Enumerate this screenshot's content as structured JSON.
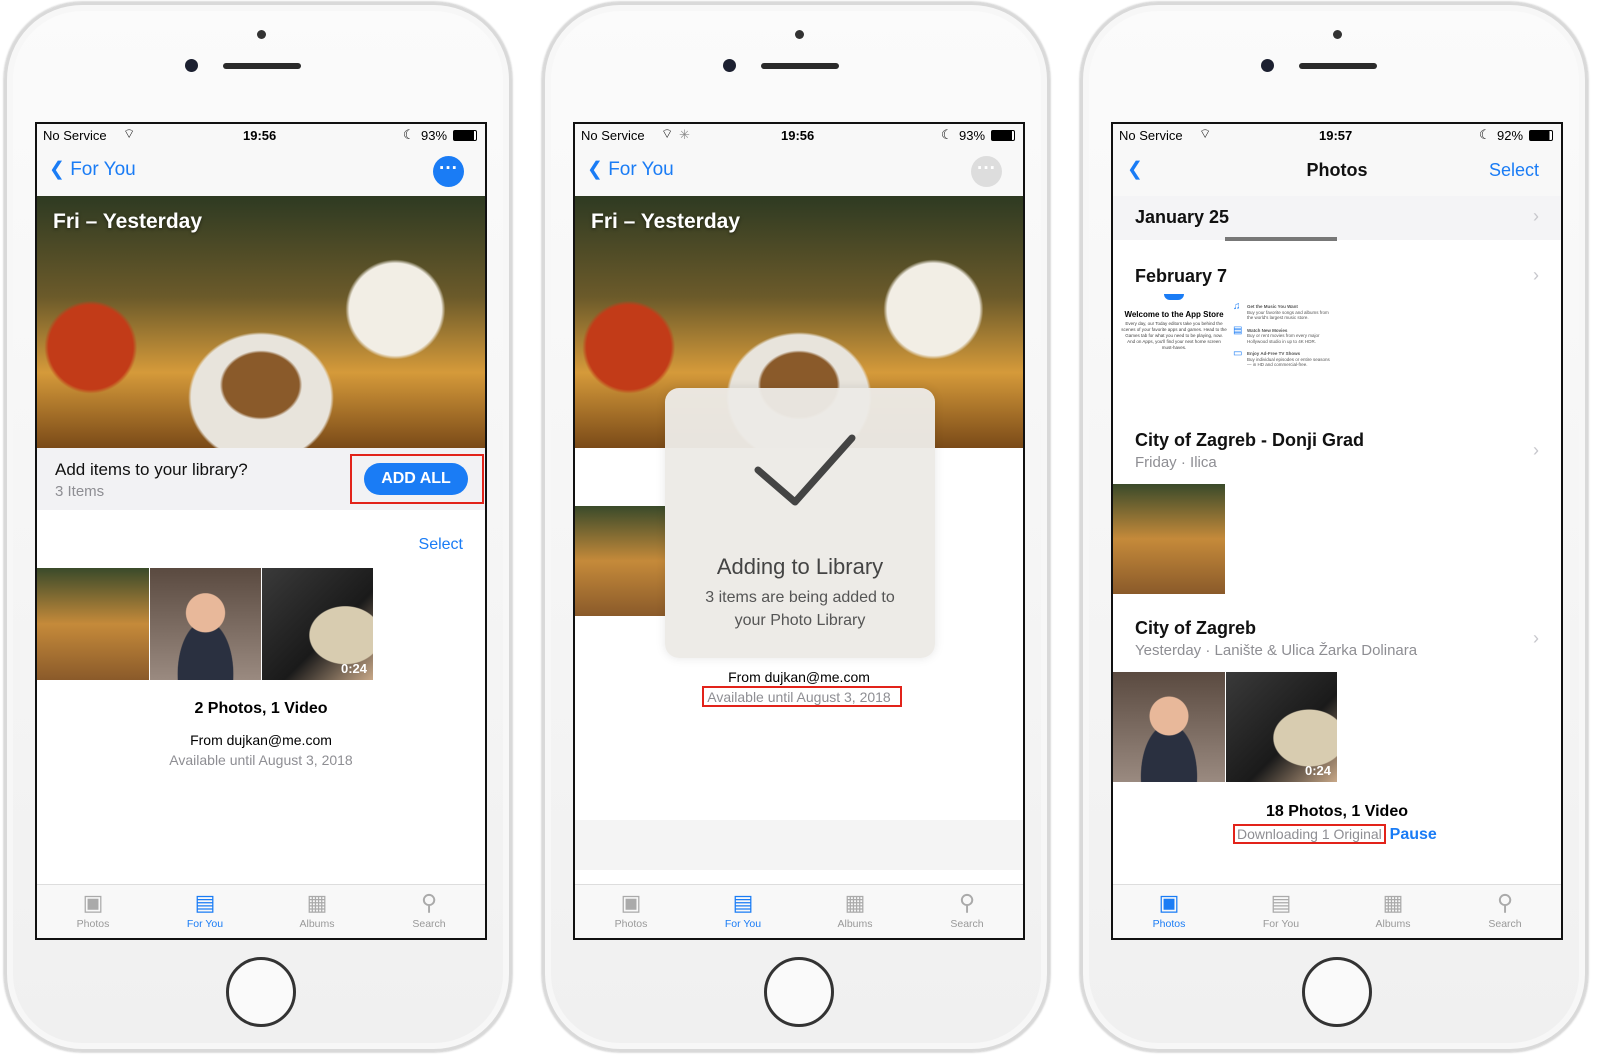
{
  "phones": [
    {
      "status": {
        "carrier": "No Service",
        "time": "19:56",
        "battery": "93%"
      },
      "nav": {
        "back_label": "For You"
      },
      "hero_title": "Fri – Yesterday",
      "banner": {
        "title": "Add items to your library?",
        "count": "3 Items",
        "button": "ADD ALL"
      },
      "select_label": "Select",
      "video_duration": "0:24",
      "summary": "2 Photos, 1 Video",
      "from": "From dujkan@me.com",
      "available": "Available until August 3, 2018"
    },
    {
      "status": {
        "carrier": "No Service",
        "time": "19:56",
        "battery": "93%"
      },
      "nav": {
        "back_label": "For You"
      },
      "hero_title": "Fri – Yesterday",
      "hud": {
        "title": "Adding to Library",
        "message": "3 items are being added to your Photo Library"
      },
      "from": "From dujkan@me.com",
      "available": "Available until August 3, 2018"
    },
    {
      "status": {
        "carrier": "No Service",
        "time": "19:57",
        "battery": "92%"
      },
      "nav": {
        "title": "Photos",
        "select": "Select"
      },
      "sections": [
        {
          "title": "January 25"
        },
        {
          "title": "February 7",
          "app_store": {
            "heading": "Welcome to the App Store",
            "body": "Every day, our Today editors take you behind the scenes of your favorite apps and games. Head to the Games tab for what you need to be playing, now. And on Apps, you'll find your next home screen must-haves.",
            "features": [
              {
                "title": "Get the Music You Want",
                "text": "Buy your favorite songs and albums from the world's largest music store."
              },
              {
                "title": "Watch New Movies",
                "text": "Buy or rent movies from every major Hollywood studio in up to 4K HDR."
              },
              {
                "title": "Enjoy Ad-Free TV Shows",
                "text": "Buy individual episodes or entire seasons — in HD and commercial-free."
              }
            ]
          }
        },
        {
          "title": "City of Zagreb - Donji Grad",
          "date": "Friday",
          "place": "Ilica"
        },
        {
          "title": "City of Zagreb",
          "date": "Yesterday",
          "place": "Lanište & Ulica Žarka Dolinara",
          "video_duration": "0:24"
        }
      ],
      "summary": "18 Photos, 1 Video",
      "downloading": "Downloading 1 Original",
      "pause": "Pause"
    }
  ],
  "tabs": [
    "Photos",
    "For You",
    "Albums",
    "Search"
  ],
  "colors": {
    "accent": "#1a7cf5",
    "highlight": "#e2231a"
  }
}
